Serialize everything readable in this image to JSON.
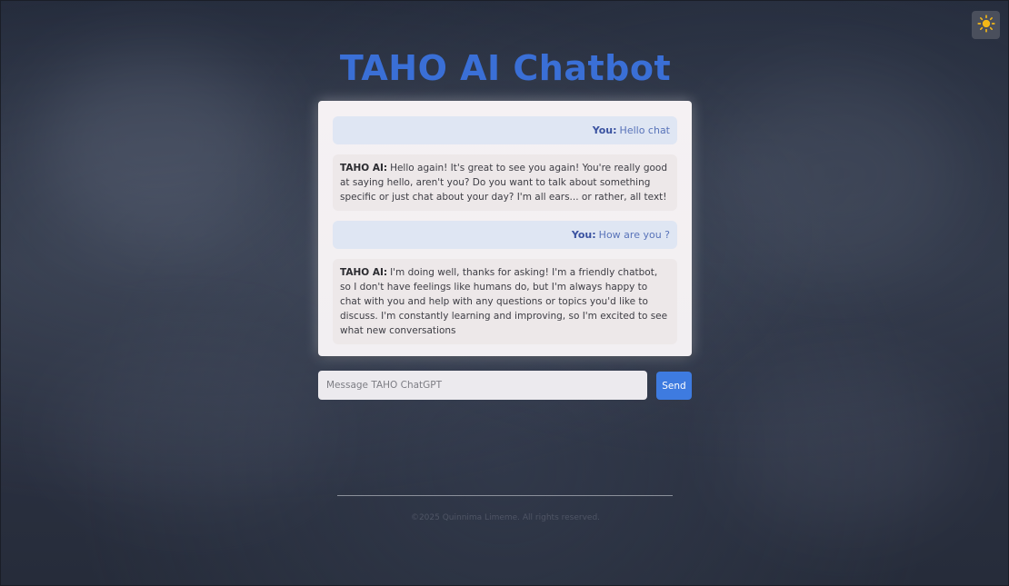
{
  "header": {
    "title": "TAHO AI Chatbot",
    "theme_toggle_icon": "sun-icon",
    "theme_toggle_color": "#f2b718"
  },
  "chat": {
    "messages": [
      {
        "role": "user",
        "sender": "You:",
        "text": "Hello chat"
      },
      {
        "role": "ai",
        "sender": "TAHO AI:",
        "text": "Hello again! It's great to see you again! You're really good at saying hello, aren't you? Do you want to talk about something specific or just chat about your day? I'm all ears... or rather, all text!"
      },
      {
        "role": "user",
        "sender": "You:",
        "text": "How are you ?"
      },
      {
        "role": "ai",
        "sender": "TAHO AI:",
        "text": "I'm doing well, thanks for asking! I'm a friendly chatbot, so I don't have feelings like humans do, but I'm always happy to chat with you and help with any questions or topics you'd like to discuss. I'm constantly learning and improving, so I'm excited to see what new conversations"
      }
    ]
  },
  "composer": {
    "placeholder": "Message TAHO ChatGPT",
    "value": "",
    "send_label": "Send"
  },
  "footer": {
    "text": "©2025 Quinnima Limeme. All rights reserved."
  },
  "colors": {
    "accent": "#3e7be0",
    "title": "#3a6fd6",
    "user_bubble": "#dfe6f3",
    "ai_bubble": "#ede8e9"
  }
}
